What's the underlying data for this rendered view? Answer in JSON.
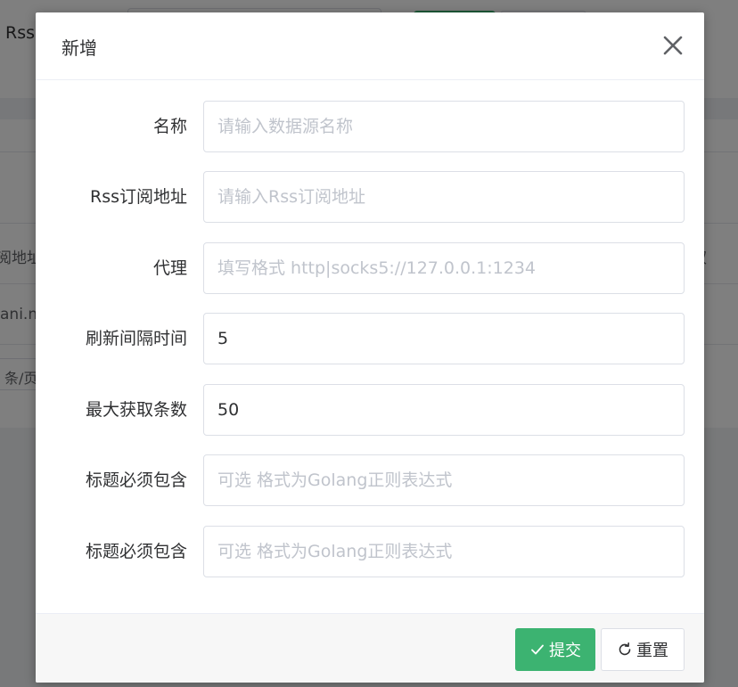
{
  "background": {
    "page_title": "Rss",
    "table_header_fragment": "阅地址",
    "table_header_right_fragment": "权",
    "row_fragment": "ani.n",
    "pager_fragment": "条/页"
  },
  "dialog": {
    "title": "新增",
    "fields": [
      {
        "label": "名称",
        "value": "",
        "placeholder": "请输入数据源名称"
      },
      {
        "label": "Rss订阅地址",
        "value": "",
        "placeholder": "请输入Rss订阅地址"
      },
      {
        "label": "代理",
        "value": "",
        "placeholder": "填写格式 http|socks5://127.0.0.1:1234"
      },
      {
        "label": "刷新间隔时间",
        "value": "5",
        "placeholder": ""
      },
      {
        "label": "最大获取条数",
        "value": "50",
        "placeholder": ""
      },
      {
        "label": "标题必须包含",
        "value": "",
        "placeholder": "可选 格式为Golang正则表达式"
      },
      {
        "label": "标题必须包含",
        "value": "",
        "placeholder": "可选 格式为Golang正则表达式"
      }
    ],
    "buttons": {
      "submit_label": "提交",
      "reset_label": "重置"
    }
  },
  "colors": {
    "primary": "#3cb371",
    "overlay": "rgba(0,0,0,0.5)",
    "placeholder": "#c0c4cc"
  },
  "icons": {
    "close": "close-icon",
    "submit": "check-icon",
    "reset": "refresh-icon"
  }
}
